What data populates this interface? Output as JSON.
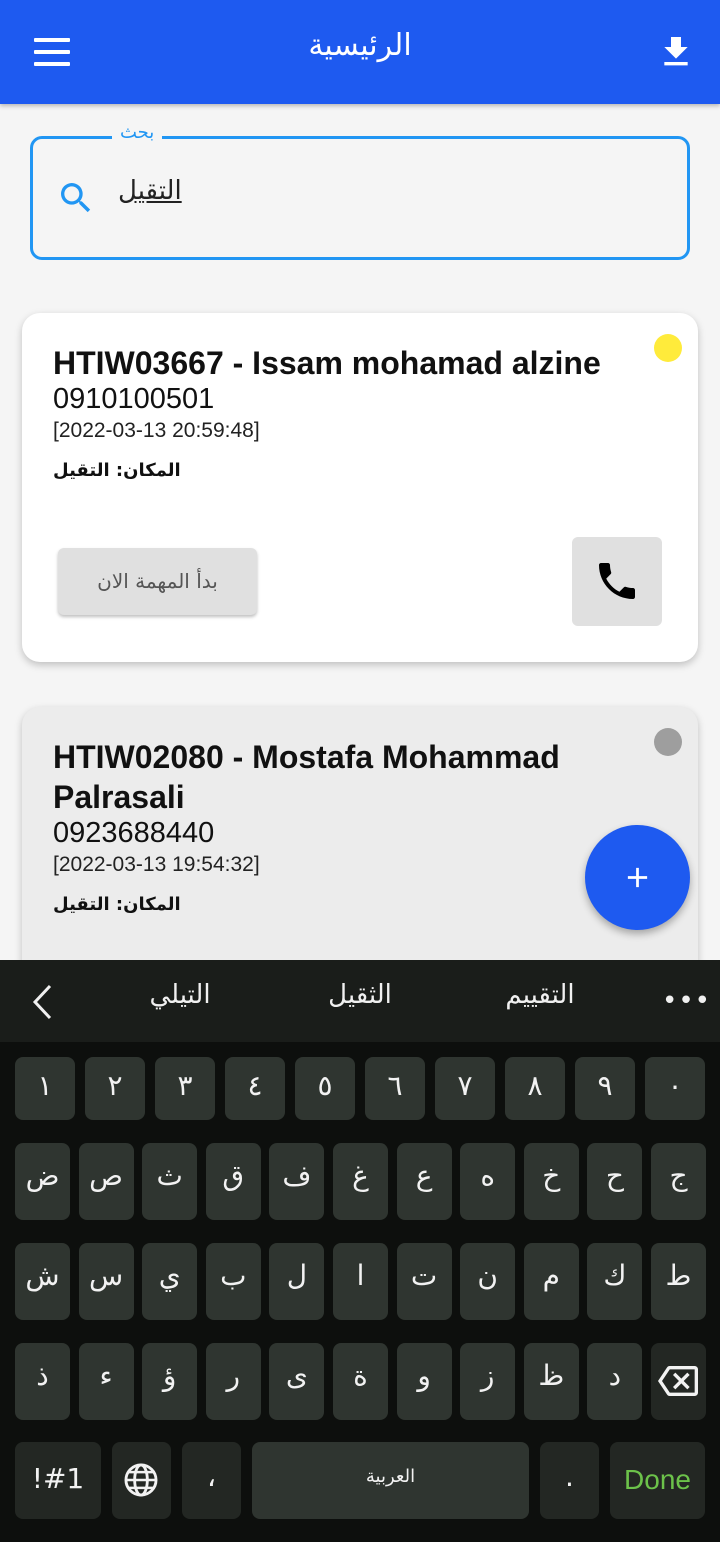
{
  "appbar": {
    "title": "الرئيسية",
    "menu_icon": "menu-icon",
    "download_icon": "download-icon",
    "color": "#1e5af0"
  },
  "search": {
    "label": "بحث",
    "value": "التقيل",
    "icon": "search-icon",
    "accent": "#2196f3"
  },
  "cards": [
    {
      "heading": "HTIW03667 - Issam mohamad alzine",
      "phone": "0910100501",
      "timestamp": "[2022-03-13 20:59:48]",
      "place": "المكان: التقيل",
      "status_color": "#ffeb3b",
      "start_label": "بدأ المهمة الان",
      "call_icon": "phone-icon"
    },
    {
      "heading": "HTIW02080 - Mostafa Mohammad Palrasali",
      "phone": "0923688440",
      "timestamp": "[2022-03-13 19:54:32]",
      "place": "المكان: التقيل",
      "status_color": "#9e9e9e"
    }
  ],
  "fab": {
    "icon": "plus-icon"
  },
  "keyboard": {
    "suggestions": [
      "التيلي",
      "الثقيل",
      "التقييم"
    ],
    "more": "•••",
    "rows": [
      [
        "١",
        "٢",
        "٣",
        "٤",
        "٥",
        "٦",
        "٧",
        "٨",
        "٩",
        "٠"
      ],
      [
        "ض",
        "ص",
        "ث",
        "ق",
        "ف",
        "غ",
        "ع",
        "ه",
        "خ",
        "ح",
        "ج"
      ],
      [
        "ش",
        "س",
        "ي",
        "ب",
        "ل",
        "ا",
        "ت",
        "ن",
        "م",
        "ك",
        "ط"
      ],
      [
        "ذ",
        "ء",
        "ؤ",
        "ر",
        "ى",
        "ة",
        "و",
        "ز",
        "ظ",
        "د"
      ]
    ],
    "symbols_key": "!#1",
    "comma_key": "،",
    "space_label": "العربية",
    "period_key": ".",
    "done_label": "Done"
  }
}
